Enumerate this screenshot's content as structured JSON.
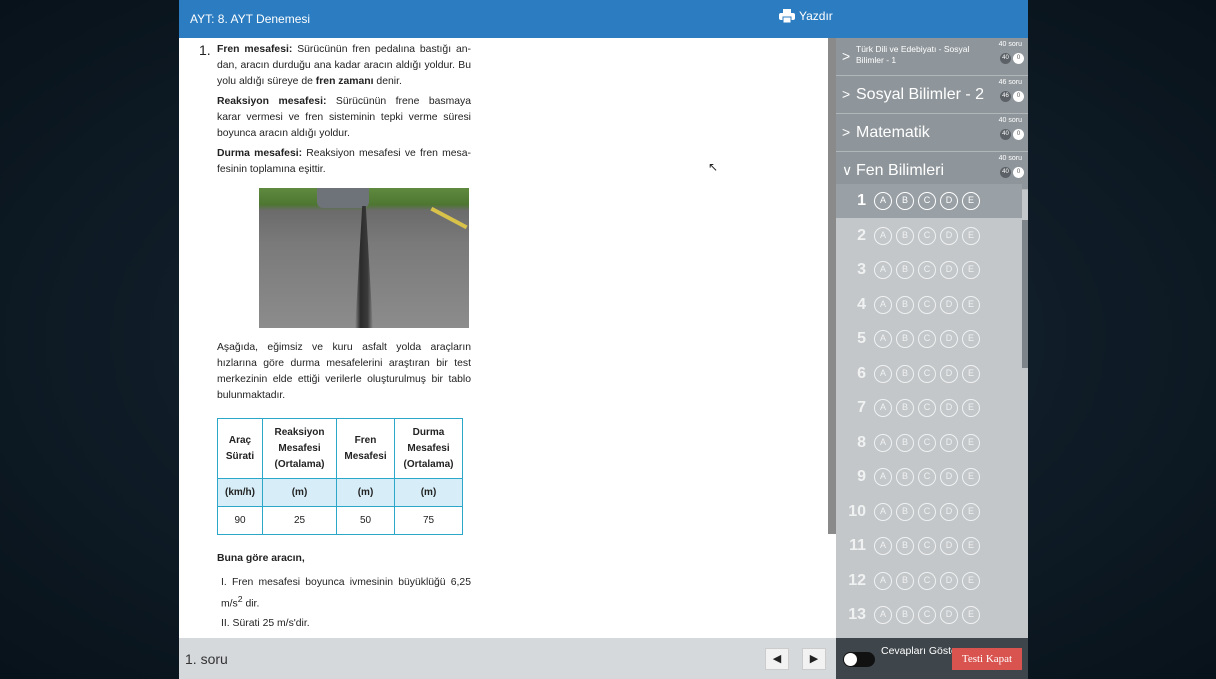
{
  "header": {
    "title": "AYT: 8. AYT Denemesi",
    "print_label": "Yazdır"
  },
  "question": {
    "number": "1.",
    "p1_bold": "Fren mesafesi:",
    "p1_text": " Sürücünün fren pedalına bastığı an-dan, aracın durduğu ana kadar aracın aldığı yoldur. Bu yolu aldığı süreye de ",
    "p1_bold2": "fren zamanı",
    "p1_text2": " denir.",
    "p2_bold": "Reaksiyon mesafesi:",
    "p2_text": " Sürücünün frene basmaya karar vermesi ve fren sisteminin tepki verme süresi boyunca aracın aldığı yoldur.",
    "p3_bold": "Durma mesafesi:",
    "p3_text": " Reaksiyon mesafesi ve fren mesa-fesinin toplamına eşittir.",
    "p4": "Aşağıda, eğimsiz ve kuru asfalt yolda araçların hızlarına göre durma mesafelerini araştıran bir test merkezinin elde ettiği verilerle oluşturulmuş bir tablo bulunmaktadır.",
    "table": {
      "headers": [
        "Araç Sürati",
        "Reaksiyon Mesafesi (Ortalama)",
        "Fren Mesafesi",
        "Durma Mesafesi (Ortalama)"
      ],
      "units": [
        "(km/h)",
        "(m)",
        "(m)",
        "(m)"
      ],
      "values": [
        "90",
        "25",
        "50",
        "75"
      ]
    },
    "lead": "Buna göre aracın,",
    "item1": "I. Fren mesafesi boyunca ivmesinin büyüklüğü 6,25 m/s",
    "item1_sup": "2",
    "item1_end": " dir.",
    "item2": "II. Sürati 25 m/s'dir."
  },
  "footer": {
    "current": "1. soru",
    "prev_icon": "◀",
    "next_icon": "▶"
  },
  "panel": {
    "sections": [
      {
        "name": "Türk Dili ve Edebiyatı - Sosyal Bilimler - 1",
        "count": "40 soru",
        "b1": "40",
        "b2": "0",
        "chev": ">"
      },
      {
        "name": "Sosyal Bilimler - 2",
        "count": "46 soru",
        "b1": "46",
        "b2": "0",
        "chev": ">"
      },
      {
        "name": "Matematik",
        "count": "40 soru",
        "b1": "40",
        "b2": "0",
        "chev": ">"
      },
      {
        "name": "Fen Bilimleri",
        "count": "40 soru",
        "b1": "40",
        "b2": "0",
        "chev": "∨"
      }
    ],
    "options": [
      "A",
      "B",
      "C",
      "D",
      "E"
    ],
    "rows": [
      "1",
      "2",
      "3",
      "4",
      "5",
      "6",
      "7",
      "8",
      "9",
      "10",
      "11",
      "12",
      "13"
    ],
    "show_answers": "Cevapları Göster",
    "close_test": "Testi Kapat"
  }
}
